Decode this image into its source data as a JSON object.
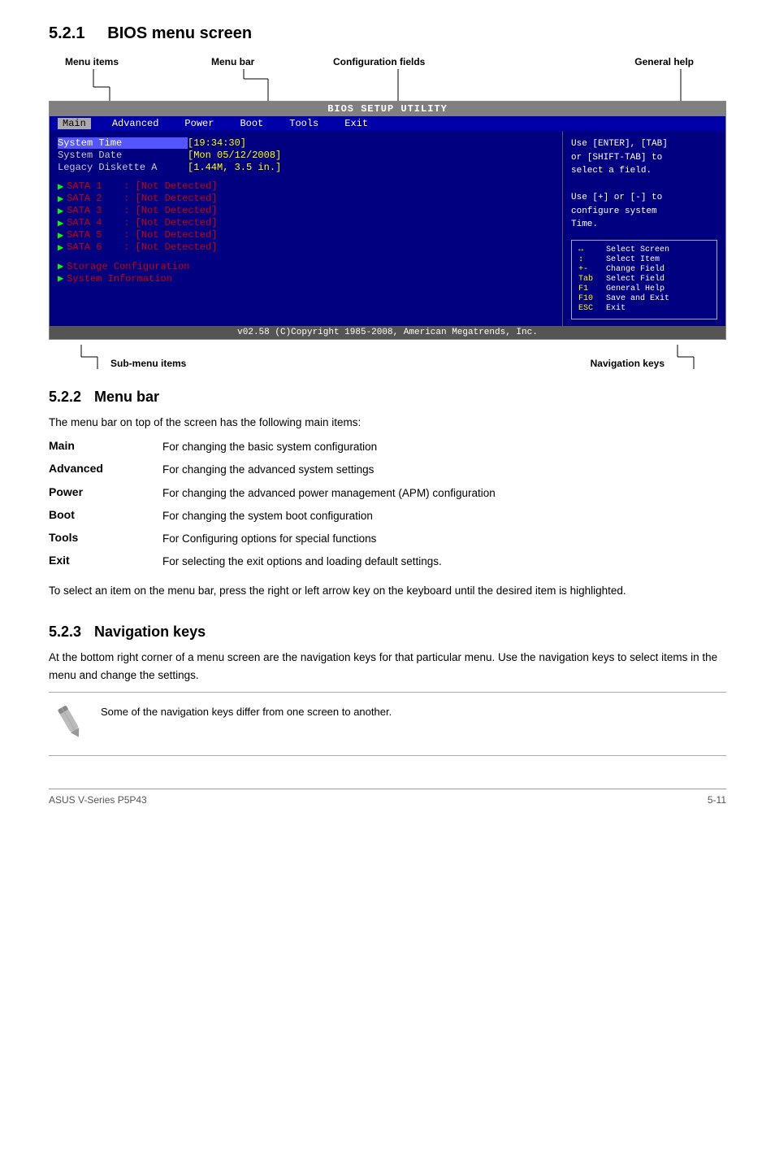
{
  "sections": {
    "s521": {
      "number": "5.2.1",
      "title": "BIOS menu screen"
    },
    "s522": {
      "number": "5.2.2",
      "title": "Menu bar"
    },
    "s523": {
      "number": "5.2.3",
      "title": "Navigation keys"
    }
  },
  "diagram": {
    "labels": {
      "menu_items": "Menu items",
      "menu_bar": "Menu bar",
      "config_fields": "Configuration fields",
      "general_help": "General help",
      "sub_menu_items": "Sub-menu items",
      "navigation_keys": "Navigation keys"
    }
  },
  "bios": {
    "title": "BIOS SETUP UTILITY",
    "menu_items": [
      "Main",
      "Advanced",
      "Power",
      "Boot",
      "Tools",
      "Exit"
    ],
    "active_menu": "Main",
    "fields": [
      {
        "label": "System Time",
        "value": "[19:34:30]",
        "highlight": true
      },
      {
        "label": "System Date",
        "value": "[Mon 05/12/2008]",
        "highlight": false
      },
      {
        "label": "Legacy Diskette A",
        "value": "[1.44M, 3.5 in.]",
        "highlight": false
      }
    ],
    "sata_items": [
      {
        "label": "SATA 1",
        "value": ": [Not Detected]"
      },
      {
        "label": "SATA 2",
        "value": ": [Not Detected]"
      },
      {
        "label": "SATA 3",
        "value": ": [Not Detected]"
      },
      {
        "label": "SATA 4",
        "value": ": [Not Detected]"
      },
      {
        "label": "SATA 5",
        "value": ": [Not Detected]"
      },
      {
        "label": "SATA 6",
        "value": ": [Not Detected]"
      }
    ],
    "sub_items": [
      "Storage Configuration",
      "System Information"
    ],
    "help_text": [
      "Use [ENTER], [TAB]",
      "or [SHIFT-TAB] to",
      "select a field.",
      "",
      "Use [+] or [-] to",
      "configure system",
      "Time."
    ],
    "nav_keys": [
      {
        "key": "↔",
        "desc": "Select Screen"
      },
      {
        "key": "↕",
        "desc": "Select Item"
      },
      {
        "key": "+-",
        "desc": "Change Field"
      },
      {
        "key": "Tab",
        "desc": "Select Field"
      },
      {
        "key": "F1",
        "desc": "General Help"
      },
      {
        "key": "F10",
        "desc": "Save and Exit"
      },
      {
        "key": "ESC",
        "desc": "Exit"
      }
    ],
    "footer": "v02.58  (C)Copyright 1985-2008, American Megatrends, Inc."
  },
  "menu_bar_section": {
    "intro": "The menu bar on top of the screen has the following main items:",
    "items": [
      {
        "term": "Main",
        "desc": "For changing the basic system configuration"
      },
      {
        "term": "Advanced",
        "desc": "For changing the advanced system settings"
      },
      {
        "term": "Power",
        "desc": "For changing the advanced power management (APM) configuration"
      },
      {
        "term": "Boot",
        "desc": "For changing the system boot configuration"
      },
      {
        "term": "Tools",
        "desc": "For Configuring options for special functions"
      },
      {
        "term": "Exit",
        "desc": "For selecting the exit options and loading default settings."
      }
    ],
    "outro": "To select an item on the menu bar, press the right or left arrow key on the keyboard until the desired item is highlighted."
  },
  "nav_keys_section": {
    "body": "At the bottom right corner of a menu screen are the navigation keys for that particular menu. Use the navigation keys to select items in the menu and change the settings."
  },
  "note": {
    "text": "Some of the navigation keys differ from one screen to another."
  },
  "footer": {
    "product": "ASUS V-Series P5P43",
    "page": "5-11"
  }
}
